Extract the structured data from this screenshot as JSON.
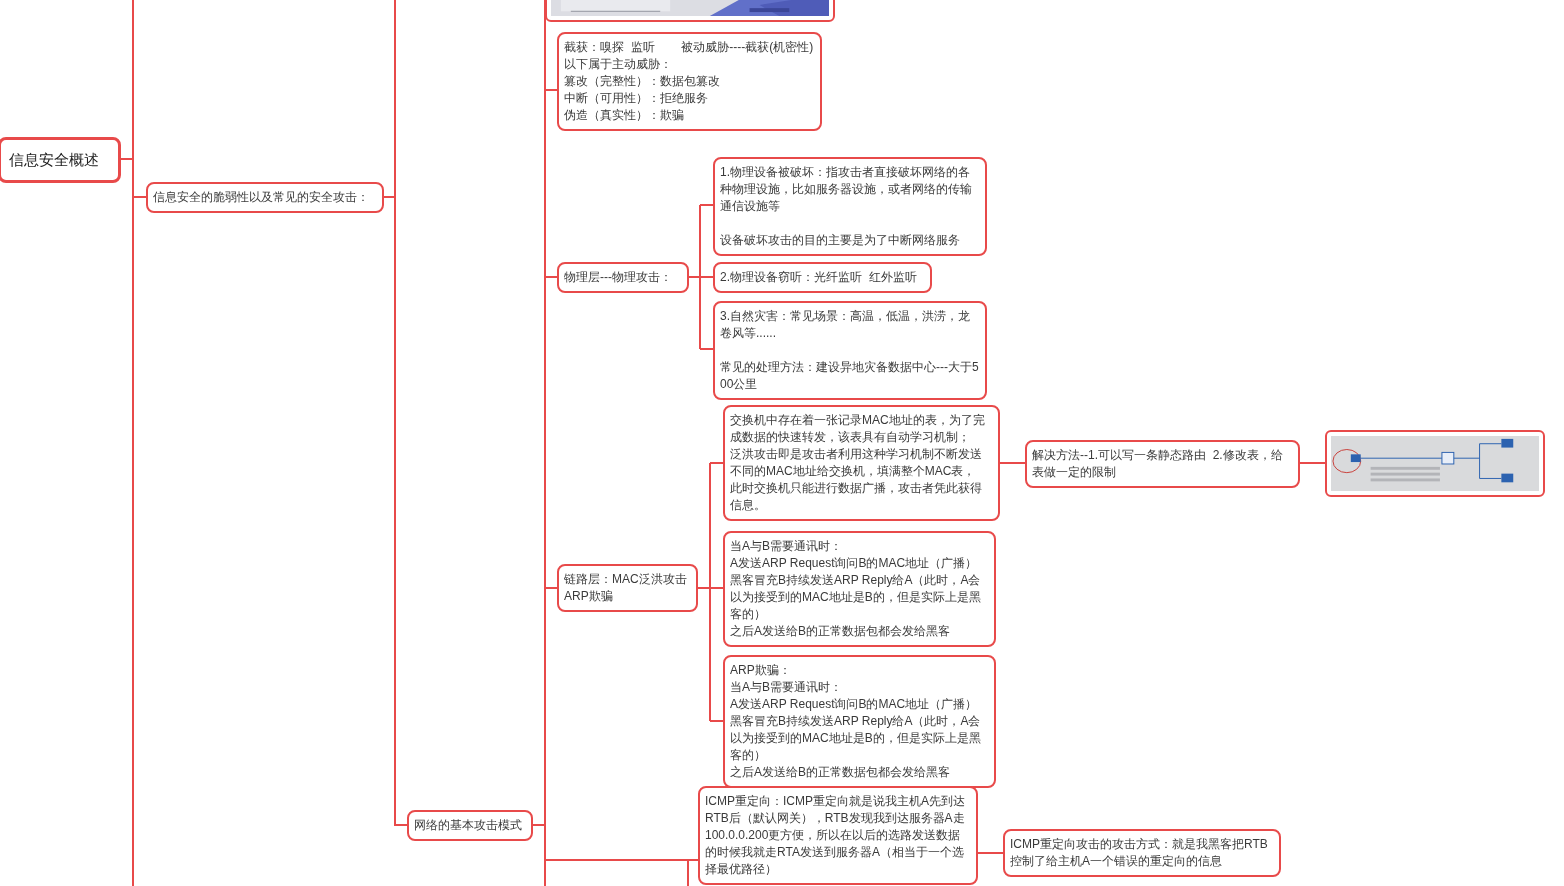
{
  "mindmap": {
    "root": {
      "kind": "root",
      "paragraphs": [
        [
          "信息安全概述"
        ]
      ],
      "children": [
        {
          "kind": "topic",
          "paragraphs": [
            [
              "信息安全的脆弱性以及常见的安全攻击："
            ]
          ],
          "children": [
            {
              "kind": "topic",
              "paragraphs": [
                [
                  "网络的基本攻击模式"
                ]
              ],
              "children": [
                {
                  "kind": "picture"
                },
                {
                  "kind": "topic",
                  "paragraphs": [
                    [
                      "截获：嗅探  监听        被动威胁----截获(机密性)",
                      "以下属于主动威胁：",
                      "篡改（完整性）：数据包篡改",
                      "中断（可用性）：拒绝服务",
                      "伪造（真实性）：欺骗"
                    ]
                  ]
                },
                {
                  "kind": "topic",
                  "paragraphs": [
                    [
                      "物理层---物理攻击："
                    ]
                  ],
                  "children": [
                    {
                      "kind": "topic",
                      "paragraphs": [
                        [
                          "1.物理设备被破坏：指攻击者直接破坏网络的各种物理设施，比如服务器设施，或者网络的传输通信设施等"
                        ],
                        [
                          "设备破坏攻击的目的主要是为了中断网络服务"
                        ]
                      ]
                    },
                    {
                      "kind": "topic",
                      "paragraphs": [
                        [
                          "2.物理设备窃听：光纤监听  红外监听"
                        ]
                      ]
                    },
                    {
                      "kind": "topic",
                      "paragraphs": [
                        [
                          "3.自然灾害：常见场景：高温，低温，洪涝，龙卷风等......"
                        ],
                        [
                          "常见的处理方法：建设异地灾备数据中心---大于500公里"
                        ]
                      ]
                    }
                  ]
                },
                {
                  "kind": "topic",
                  "paragraphs": [
                    [
                      "链路层：MAC泛洪攻击",
                      "ARP欺骗"
                    ]
                  ],
                  "children": [
                    {
                      "kind": "topic",
                      "paragraphs": [
                        [
                          "交换机中存在着一张记录MAC地址的表，为了完成数据的快速转发，该表具有自动学习机制；",
                          "泛洪攻击即是攻击者利用这种学习机制不断发送不同的MAC地址给交换机，填满整个MAC表，",
                          "此时交换机只能进行数据广播，攻击者凭此获得信息。"
                        ]
                      ],
                      "children": [
                        {
                          "kind": "topic",
                          "paragraphs": [
                            [
                              "解决方法--1.可以写一条静态路由  2.修改表，给表做一定的限制"
                            ]
                          ],
                          "children": [
                            {
                              "kind": "picture"
                            }
                          ]
                        }
                      ]
                    },
                    {
                      "kind": "topic",
                      "paragraphs": [
                        [
                          "当A与B需要通讯时：",
                          "A发送ARP Request询问B的MAC地址（广播）",
                          "黑客冒充B持续发送ARP Reply给A（此时，A会以为接受到的MAC地址是B的，但是实际上是黑客的）",
                          "之后A发送给B的正常数据包都会发给黑客"
                        ]
                      ]
                    },
                    {
                      "kind": "topic",
                      "paragraphs": [
                        [
                          "ARP欺骗：",
                          "当A与B需要通讯时：",
                          "A发送ARP Request询问B的MAC地址（广播）",
                          "黑客冒充B持续发送ARP Reply给A（此时，A会以为接受到的MAC地址是B的，但是实际上是黑客的）",
                          "之后A发送给B的正常数据包都会发给黑客"
                        ]
                      ]
                    }
                  ]
                },
                {
                  "kind": "topic",
                  "paragraphs": [
                    [
                      "ICMP重定向：ICMP重定向就是说我主机A先到达RTB后（默认网关），RTB发现我到达服务器A走100.0.0.200更方便，所以在以后的选路发送数据的时候我就走RTA发送到服务器A（相当于一个选择最优路径）"
                    ]
                  ],
                  "children": [
                    {
                      "kind": "topic",
                      "paragraphs": [
                        [
                          "ICMP重定向攻击的攻击方式：就是我黑客把RTB控制了给主机A一个错误的重定向的信息"
                        ]
                      ]
                    }
                  ]
                }
              ]
            }
          ]
        }
      ]
    }
  }
}
